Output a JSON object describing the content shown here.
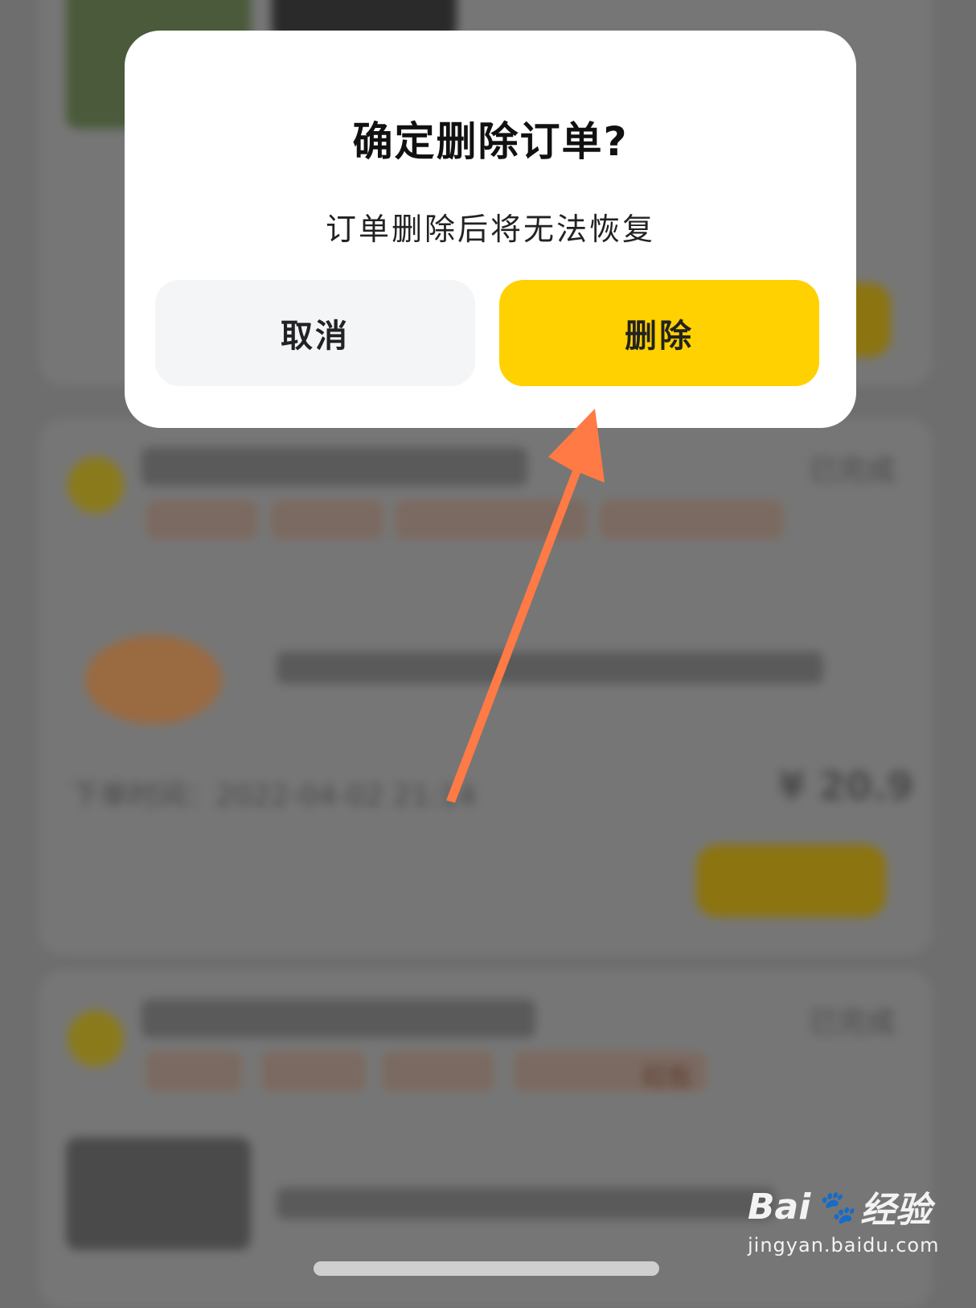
{
  "dialog": {
    "title": "确定删除订单?",
    "subtitle": "订单删除后将无法恢复",
    "cancel_label": "取消",
    "delete_label": "删除"
  },
  "background": {
    "order2_status": "已完成",
    "order2_time": "下单时间：2022-04-02 21:14",
    "order2_total": "¥ 20.9",
    "order3_status": "已完成",
    "order3_tag": "红包"
  },
  "watermark": {
    "brand": "Bai",
    "brand_suffix": "经验",
    "url": "jingyan.baidu.com"
  },
  "colors": {
    "accent": "#ffd100",
    "arrow": "#ff7a45",
    "overlay": "#6e6e6e"
  }
}
